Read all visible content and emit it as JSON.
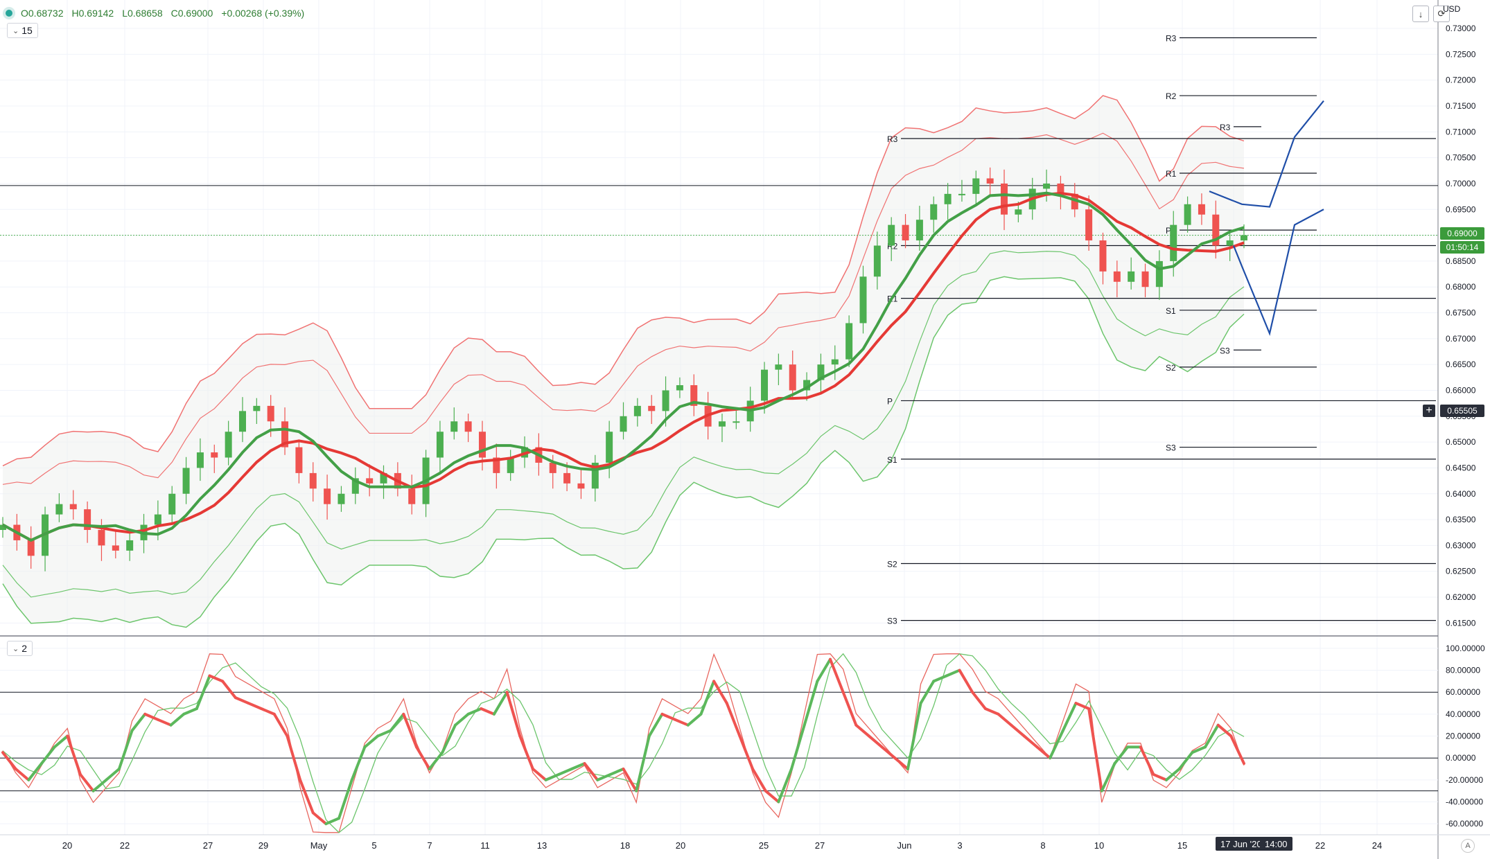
{
  "header": {
    "open": "O0.68732",
    "high": "H0.69142",
    "low": "L0.68658",
    "close": "C0.69000",
    "change": "+0.00268 (+0.39%)",
    "interval": "15",
    "currency": "USD"
  },
  "oscillator": {
    "label": "2"
  },
  "price_tags": {
    "last_price": "0.69000",
    "countdown": "01:50:14",
    "crosshair_price": "0.65505"
  },
  "date_tags": {
    "date": "17 Jun '20",
    "time": "14:00"
  },
  "icons": {
    "down_arrow": "↓",
    "refresh": "⟳",
    "cross": "+",
    "auto_scale": "A"
  },
  "colors": {
    "bull": "#4caf50",
    "bear": "#ef5350",
    "ma_fast": "#43a047",
    "ma_slow": "#e53935",
    "band_upper": "#f07272",
    "band_lower": "#6cc56c",
    "projection": "#1f4ea8",
    "price_tag": "#3b9b3b"
  },
  "chart_data": {
    "type": "candlestick",
    "symbol_currency": "USD",
    "ylim": [
      0.6125,
      0.7355
    ],
    "y_ticks": [
      "0.73000",
      "0.72500",
      "0.72000",
      "0.71500",
      "0.71000",
      "0.70500",
      "0.70000",
      "0.69500",
      "0.69000",
      "0.68500",
      "0.68000",
      "0.67500",
      "0.67000",
      "0.66500",
      "0.66000",
      "0.65500",
      "0.65000",
      "0.64500",
      "0.64000",
      "0.63500",
      "0.63000",
      "0.62500",
      "0.62000",
      "0.61500"
    ],
    "x_ticks": [
      "20",
      "22",
      "27",
      "29",
      "May",
      "5",
      "7",
      "11",
      "13",
      "18",
      "20",
      "25",
      "27",
      "Jun",
      "3",
      "8",
      "10",
      "15",
      "17 Jun '20",
      "22",
      "24"
    ],
    "price_series": [
      0.634,
      0.631,
      0.628,
      0.636,
      0.638,
      0.637,
      0.633,
      0.63,
      0.629,
      0.631,
      0.634,
      0.636,
      0.64,
      0.645,
      0.648,
      0.647,
      0.652,
      0.656,
      0.657,
      0.654,
      0.649,
      0.644,
      0.641,
      0.638,
      0.64,
      0.643,
      0.642,
      0.644,
      0.641,
      0.638,
      0.647,
      0.652,
      0.654,
      0.652,
      0.647,
      0.644,
      0.647,
      0.649,
      0.646,
      0.644,
      0.642,
      0.641,
      0.646,
      0.652,
      0.655,
      0.657,
      0.656,
      0.66,
      0.661,
      0.657,
      0.653,
      0.654,
      0.654,
      0.658,
      0.664,
      0.665,
      0.66,
      0.662,
      0.665,
      0.666,
      0.673,
      0.682,
      0.688,
      0.692,
      0.689,
      0.693,
      0.696,
      0.698,
      0.698,
      0.701,
      0.7,
      0.694,
      0.695,
      0.699,
      0.7,
      0.698,
      0.695,
      0.689,
      0.683,
      0.681,
      0.683,
      0.68,
      0.685,
      0.692,
      0.696,
      0.694,
      0.688,
      0.689,
      0.69
    ],
    "reference_lines": [
      0.6996,
      0.69
    ],
    "pivot_levels_left": [
      {
        "label": "R3",
        "value": 0.7087
      },
      {
        "label": "R2",
        "value": 0.688
      },
      {
        "label": "R1",
        "value": 0.6778
      },
      {
        "label": "P",
        "value": 0.658
      },
      {
        "label": "S1",
        "value": 0.6467
      },
      {
        "label": "S2",
        "value": 0.6265
      },
      {
        "label": "S3",
        "value": 0.6155
      }
    ],
    "pivot_levels_right": [
      {
        "label": "R3",
        "value": 0.7282
      },
      {
        "label": "R2",
        "value": 0.717
      },
      {
        "label": "R1",
        "value": 0.702
      },
      {
        "label": "P",
        "value": 0.691
      },
      {
        "label": "S1",
        "value": 0.6755
      },
      {
        "label": "S2",
        "value": 0.6645
      },
      {
        "label": "S3",
        "value": 0.649
      }
    ],
    "pivot_levels_small": [
      {
        "label": "R3",
        "value": 0.711
      },
      {
        "label": "S3",
        "value": 0.6678
      }
    ],
    "projection_path": [
      [
        0.696,
        0.684
      ],
      [
        0.6955,
        0.671
      ],
      [
        0.709,
        0.692
      ],
      [
        0.716,
        0.695
      ]
    ],
    "oscillator": {
      "ylim": [
        -70,
        105
      ],
      "y_ticks": [
        "100.00000",
        "80.00000",
        "60.00000",
        "40.00000",
        "20.00000",
        "0.00000",
        "-20.00000",
        "-40.00000",
        "-60.00000"
      ],
      "levels": [
        60,
        0,
        -30
      ],
      "main_series": [
        5,
        -10,
        -20,
        -5,
        10,
        20,
        -15,
        -30,
        -20,
        -10,
        25,
        40,
        35,
        30,
        40,
        45,
        75,
        70,
        55,
        50,
        45,
        40,
        20,
        -20,
        -50,
        -60,
        -55,
        -20,
        10,
        20,
        25,
        40,
        10,
        -10,
        5,
        30,
        40,
        45,
        40,
        60,
        20,
        -10,
        -20,
        -15,
        -10,
        -5,
        -20,
        -15,
        -10,
        -30,
        20,
        40,
        35,
        30,
        40,
        70,
        50,
        20,
        -10,
        -30,
        -40,
        -10,
        30,
        70,
        90,
        60,
        30,
        20,
        10,
        0,
        -10,
        50,
        70,
        75,
        80,
        60,
        45,
        40,
        30,
        20,
        10,
        0,
        25,
        50,
        45,
        -30,
        -5,
        10,
        10,
        -15,
        -20,
        -10,
        5,
        10,
        30,
        20,
        -5
      ]
    }
  }
}
